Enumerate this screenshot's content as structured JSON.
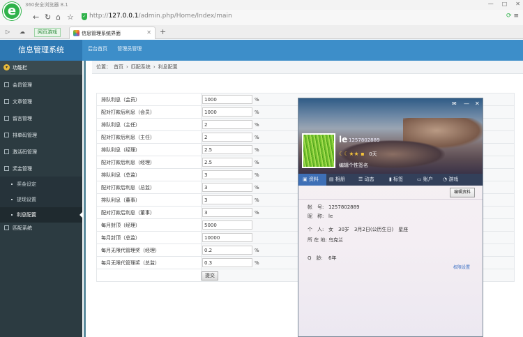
{
  "browser": {
    "app_name": "360安全浏览器 8.1",
    "url_prefix": "http://",
    "url_host": "127.0.0.1",
    "url_path": "/admin.php/Home/Index/main",
    "bookmark": "网页游戏",
    "tab_title": "信息管理系统界面"
  },
  "header": {
    "brand": "信息管理系统",
    "nav": [
      "后台首页",
      "管理员管理"
    ]
  },
  "sidebar": {
    "title": "功能栏",
    "items": [
      {
        "label": "会员管理"
      },
      {
        "label": "文章管理"
      },
      {
        "label": "留言管理"
      },
      {
        "label": "排单码管理"
      },
      {
        "label": "激活码管理"
      },
      {
        "label": "奖金管理"
      }
    ],
    "subitems": [
      {
        "label": "奖金设定"
      },
      {
        "label": "提现设置"
      },
      {
        "label": "利息配置"
      }
    ],
    "last_item": {
      "label": "匹配系统"
    }
  },
  "breadcrumb": [
    "位置：",
    "首页",
    "›",
    "匹配系统",
    "›",
    "利息配置"
  ],
  "form": {
    "rows": [
      {
        "label": "排队利息（会员）",
        "value": "1000",
        "unit": "%"
      },
      {
        "label": "配对打款后利息（会员）",
        "value": "1000",
        "unit": "%"
      },
      {
        "label": "排队利息（主任）",
        "value": "2",
        "unit": "%"
      },
      {
        "label": "配对打款后利息（主任）",
        "value": "2",
        "unit": "%"
      },
      {
        "label": "排队利息（经理）",
        "value": "2.5",
        "unit": "%"
      },
      {
        "label": "配对打款后利息（经理）",
        "value": "2.5",
        "unit": "%"
      },
      {
        "label": "排队利息（总监）",
        "value": "3",
        "unit": "%"
      },
      {
        "label": "配对打款后利息（总监）",
        "value": "3",
        "unit": "%"
      },
      {
        "label": "排队利息（董事）",
        "value": "3",
        "unit": "%"
      },
      {
        "label": "配对打款后利息（董事）",
        "value": "3",
        "unit": "%"
      },
      {
        "label": "每月封顶（经理）",
        "value": "5000",
        "unit": ""
      },
      {
        "label": "每月封顶（总监）",
        "value": "10000",
        "unit": ""
      },
      {
        "label": "每月无限代管理奖（经理）",
        "value": "0.2",
        "unit": "%"
      },
      {
        "label": "每月无限代管理奖（总监）",
        "value": "0.3",
        "unit": "%"
      }
    ],
    "submit": "提交"
  },
  "popup": {
    "nickname": "le",
    "qq": "1257802889",
    "level_days": "0天",
    "signature": "编辑个性签名",
    "tabs": [
      "资料",
      "相册",
      "动态",
      "标签",
      "账户",
      "游戏"
    ],
    "edit_button": "编辑资料",
    "info": [
      {
        "key": "帐　号:",
        "value": "1257802889"
      },
      {
        "key": "昵　称:",
        "value": "le"
      },
      {
        "key": "个　人:",
        "value": "女　30岁　3月2日(公历生日)　星座"
      },
      {
        "key": "所 在 地:",
        "value": "乌克兰"
      },
      {
        "key": "Q　龄:",
        "value": "6年"
      }
    ],
    "privacy": "权限设置"
  }
}
